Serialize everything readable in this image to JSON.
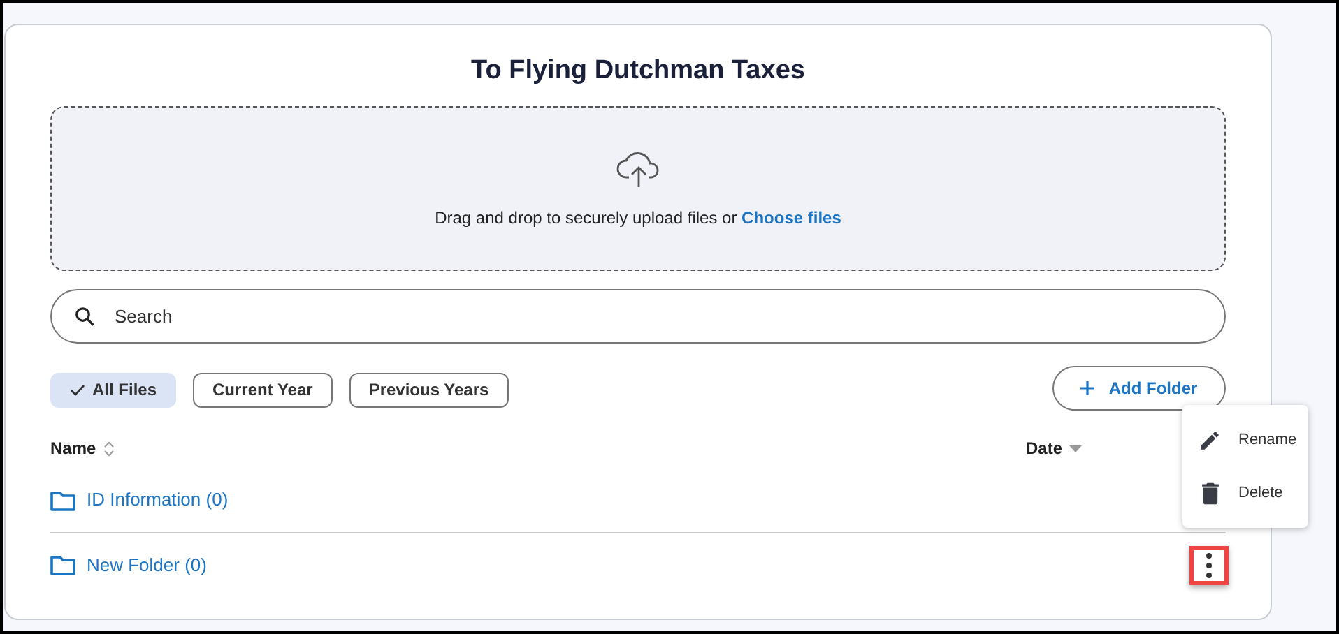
{
  "title": "To Flying Dutchman Taxes",
  "upload": {
    "text": "Drag and drop to securely upload files or ",
    "link": "Choose files"
  },
  "search": {
    "placeholder": "Search"
  },
  "filters": [
    {
      "label": "All Files",
      "selected": true
    },
    {
      "label": "Current Year",
      "selected": false
    },
    {
      "label": "Previous Years",
      "selected": false
    }
  ],
  "add_folder": "Add Folder",
  "columns": [
    {
      "label": "Name",
      "kind": "sortable"
    },
    {
      "label": "Date",
      "kind": "sorted"
    }
  ],
  "rows": [
    {
      "name": "ID Information (0)",
      "menu_highlighted": false
    },
    {
      "name": "New Folder (0)",
      "menu_highlighted": true
    }
  ],
  "menu": [
    {
      "label": "Rename",
      "kind": "rename"
    },
    {
      "label": "Delete",
      "kind": "delete"
    }
  ]
}
